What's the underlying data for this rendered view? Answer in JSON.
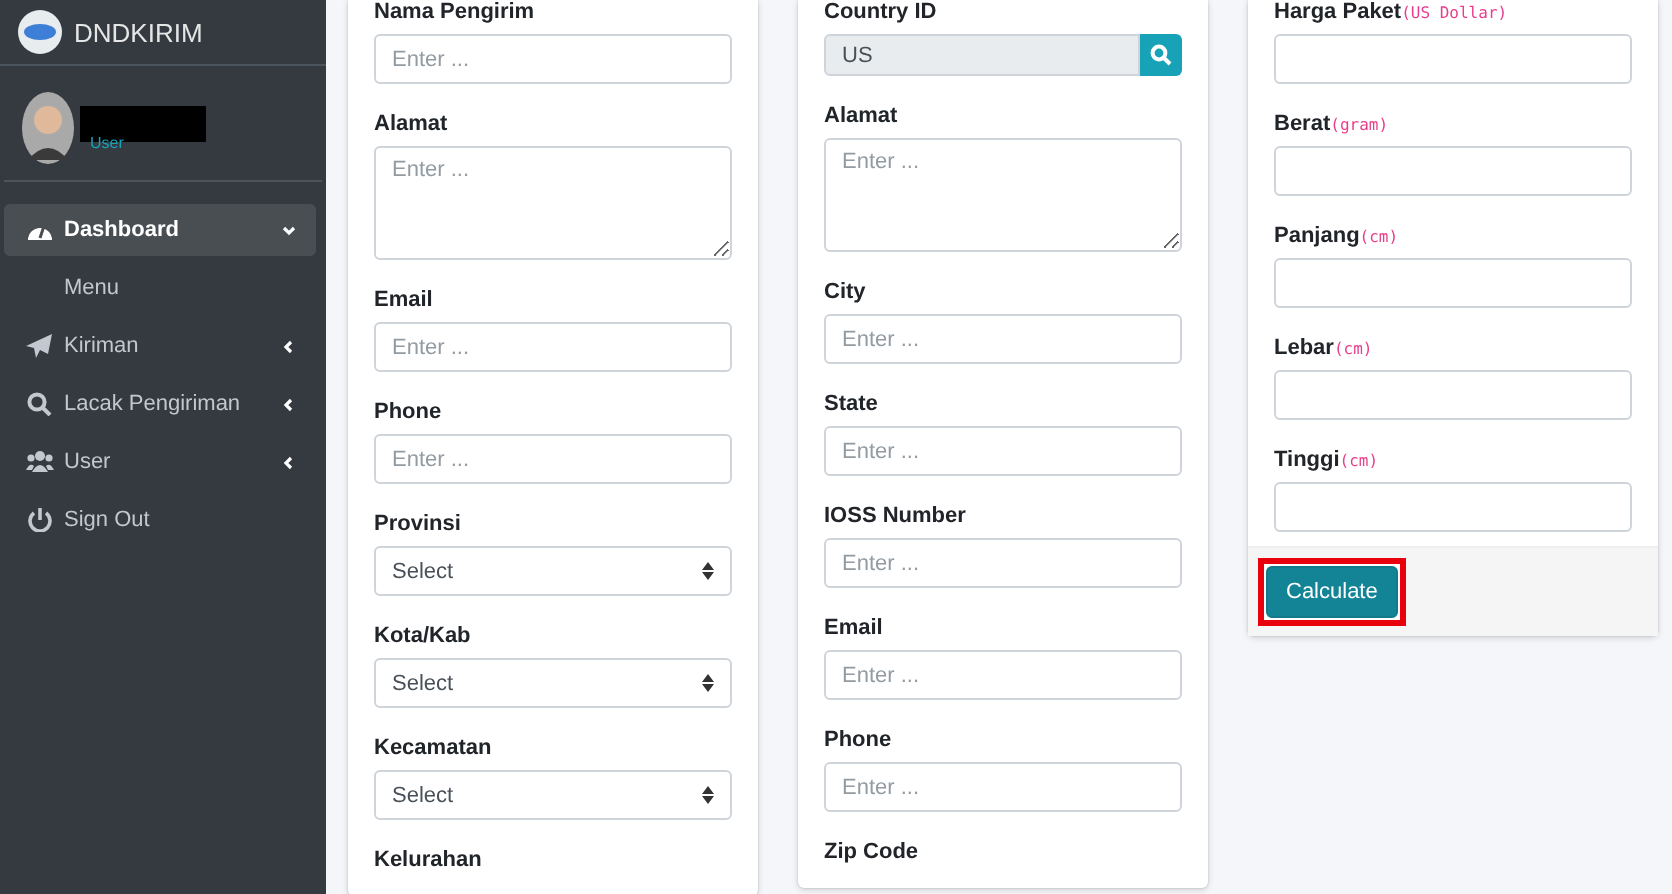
{
  "sidebar": {
    "brand": "DNDKIRIM",
    "user": {
      "role": "User"
    },
    "items": [
      {
        "label": "Dashboard",
        "selected": true,
        "expanded": true,
        "children": [
          {
            "label": "Menu"
          }
        ]
      },
      {
        "label": "Kiriman",
        "selected": false,
        "expanded": false
      },
      {
        "label": "Lacak Pengiriman",
        "selected": false,
        "expanded": false
      },
      {
        "label": "User",
        "selected": false,
        "expanded": false
      },
      {
        "label": "Sign Out",
        "selected": false
      }
    ]
  },
  "columns": [
    {
      "fields": [
        {
          "kind": "input",
          "label": "Nama Pengirim",
          "placeholder": "Enter ..."
        },
        {
          "kind": "textarea",
          "label": "Alamat",
          "placeholder": "Enter ..."
        },
        {
          "kind": "input",
          "label": "Email",
          "placeholder": "Enter ..."
        },
        {
          "kind": "input",
          "label": "Phone",
          "placeholder": "Enter ..."
        },
        {
          "kind": "select",
          "label": "Provinsi",
          "value": "Select"
        },
        {
          "kind": "select",
          "label": "Kota/Kab",
          "value": "Select"
        },
        {
          "kind": "select",
          "label": "Kecamatan",
          "value": "Select"
        },
        {
          "kind": "label",
          "label": "Kelurahan"
        }
      ]
    },
    {
      "fields": [
        {
          "kind": "search",
          "label": "Country ID",
          "value": "US"
        },
        {
          "kind": "textarea",
          "label": "Alamat",
          "placeholder": "Enter ..."
        },
        {
          "kind": "input",
          "label": "City",
          "placeholder": "Enter ..."
        },
        {
          "kind": "input",
          "label": "State",
          "placeholder": "Enter ..."
        },
        {
          "kind": "input",
          "label": "IOSS Number",
          "placeholder": "Enter ..."
        },
        {
          "kind": "input",
          "label": "Email",
          "placeholder": "Enter ..."
        },
        {
          "kind": "input",
          "label": "Phone",
          "placeholder": "Enter ..."
        },
        {
          "kind": "label",
          "label": "Zip Code"
        }
      ]
    },
    {
      "fields": [
        {
          "kind": "input",
          "label": "Harga Paket",
          "unit": "(US Dollar)"
        },
        {
          "kind": "input",
          "label": "Berat",
          "unit": "(gram)"
        },
        {
          "kind": "input",
          "label": "Panjang",
          "unit": "(cm)"
        },
        {
          "kind": "input",
          "label": "Lebar",
          "unit": "(cm)"
        },
        {
          "kind": "input",
          "label": "Tinggi",
          "unit": "(cm)"
        }
      ],
      "footer": {
        "button": "Calculate",
        "highlighted": true
      }
    }
  ]
}
